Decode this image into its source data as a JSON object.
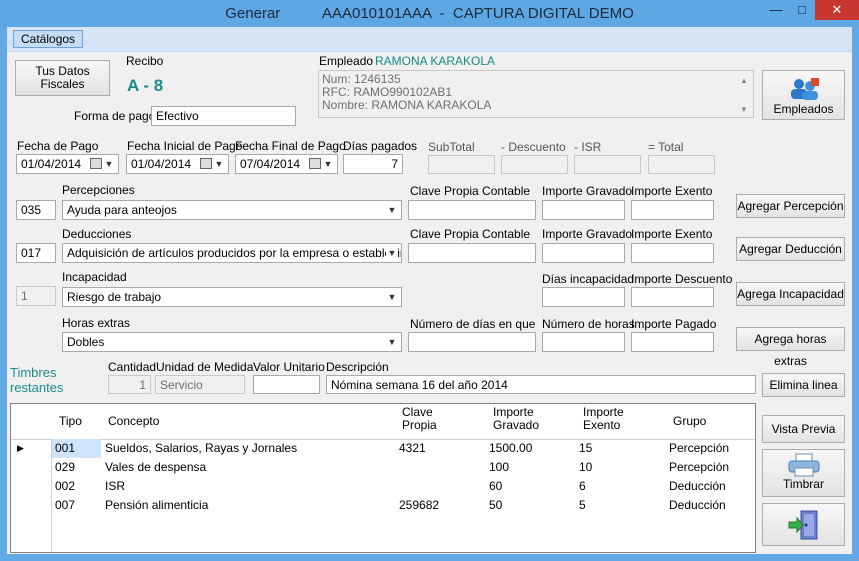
{
  "window": {
    "title_left": "Generar",
    "title_right": "AAA010101AAA  -  CAPTURA DIGITAL DEMO",
    "minimize": "—",
    "maximize": "□",
    "close": "✕"
  },
  "menu": {
    "catalogos": "Catálogos"
  },
  "top": {
    "tus_datos_line1": "Tus Datos",
    "tus_datos_line2": "Fiscales",
    "recibo_label": "Recibo",
    "recibo_value": "A - 8",
    "forma_pago_label": "Forma de pago",
    "forma_pago_value": "Efectivo",
    "empleado_label": "Empleado",
    "empleado_name": "RAMONA KARAKOLA",
    "empleado_num": "Num: 1246135",
    "empleado_rfc": "RFC: RAMO990102AB1",
    "empleado_nombre": "Nombre: RAMONA KARAKOLA",
    "empleados_button": "Empleados"
  },
  "dates": {
    "fecha_pago_label": "Fecha de Pago",
    "fecha_pago_value": "01/04/2014",
    "fecha_inicial_label": "Fecha Inicial de Pago",
    "fecha_inicial_value": "01/04/2014",
    "fecha_final_label": "Fecha Final de Pago",
    "fecha_final_value": "07/04/2014",
    "dias_pagados_label": "Días pagados",
    "dias_pagados_value": "7",
    "subtotal_label": "SubTotal",
    "descuento_label": "- Descuento",
    "isr_label": "- ISR",
    "total_label": "= Total"
  },
  "percepciones": {
    "label": "Percepciones",
    "code": "035",
    "selected": "Ayuda para anteojos",
    "clave_label": "Clave Propia Contable",
    "gravado_label": "Importe Gravado",
    "exento_label": "Importe Exento",
    "button": "Agregar Percepción"
  },
  "deducciones": {
    "label": "Deducciones",
    "code": "017",
    "selected": "Adquisición de artículos producidos por la empresa o establecimien",
    "clave_label": "Clave Propia Contable",
    "gravado_label": "Importe Gravado",
    "exento_label": "Importe Exento",
    "button": "Agregar Deducción"
  },
  "incapacidad": {
    "label": "Incapacidad",
    "code": "1",
    "selected": "Riesgo de trabajo",
    "dias_label": "Días incapacidad",
    "descuento_label": "Importe Descuento",
    "button": "Agrega Incapacidad"
  },
  "horas": {
    "label": "Horas extras",
    "selected": "Dobles",
    "dias_label": "Número de días en que",
    "horas_label": "Número de horas",
    "pagado_label": "Importe Pagado",
    "button": "Agrega horas extras"
  },
  "concepto": {
    "timbres_line1": "Timbres",
    "timbres_line2": "restantes",
    "cantidad_label": "Cantidad",
    "cantidad_value": "1",
    "unidad_label": "Unidad de Medida",
    "unidad_value": "Servicio",
    "valor_label": "Valor Unitario",
    "descripcion_label": "Descripción",
    "descripcion_value": "Nómina semana 16 del año 2014",
    "elimina_button": "Elimina linea"
  },
  "grid": {
    "headers": {
      "tipo": "Tipo",
      "concepto": "Concepto",
      "clave_l1": "Clave",
      "clave_l2": "Propia",
      "gravado_l1": "Importe",
      "gravado_l2": "Gravado",
      "exento_l1": "Importe",
      "exento_l2": "Exento",
      "grupo": "Grupo"
    },
    "row_marker": "▶",
    "rows": [
      {
        "tipo": "001",
        "concepto": "Sueldos, Salarios, Rayas y Jornales",
        "clave": "4321",
        "gravado": "1500.00",
        "exento": "15",
        "grupo": "Percepción"
      },
      {
        "tipo": "029",
        "concepto": "Vales de despensa",
        "clave": "",
        "gravado": "100",
        "exento": "10",
        "grupo": "Percepción"
      },
      {
        "tipo": "002",
        "concepto": "ISR",
        "clave": "",
        "gravado": "60",
        "exento": "6",
        "grupo": "Deducción"
      },
      {
        "tipo": "007",
        "concepto": "Pensión alimenticia",
        "clave": "259682",
        "gravado": "50",
        "exento": "5",
        "grupo": "Deducción"
      }
    ]
  },
  "side": {
    "vista_previa": "Vista Previa",
    "timbrar": "Timbrar"
  },
  "icons": [
    "users-icon",
    "printer-icon",
    "exit-door-icon",
    "calendar-icon",
    "chevron-down-icon"
  ],
  "colors": {
    "title_bar": "#5ca7e4",
    "recibo_accent": "#1f8a8a",
    "empleado_accent": "#138a8a",
    "timbres_accent": "#1f8a8a"
  }
}
